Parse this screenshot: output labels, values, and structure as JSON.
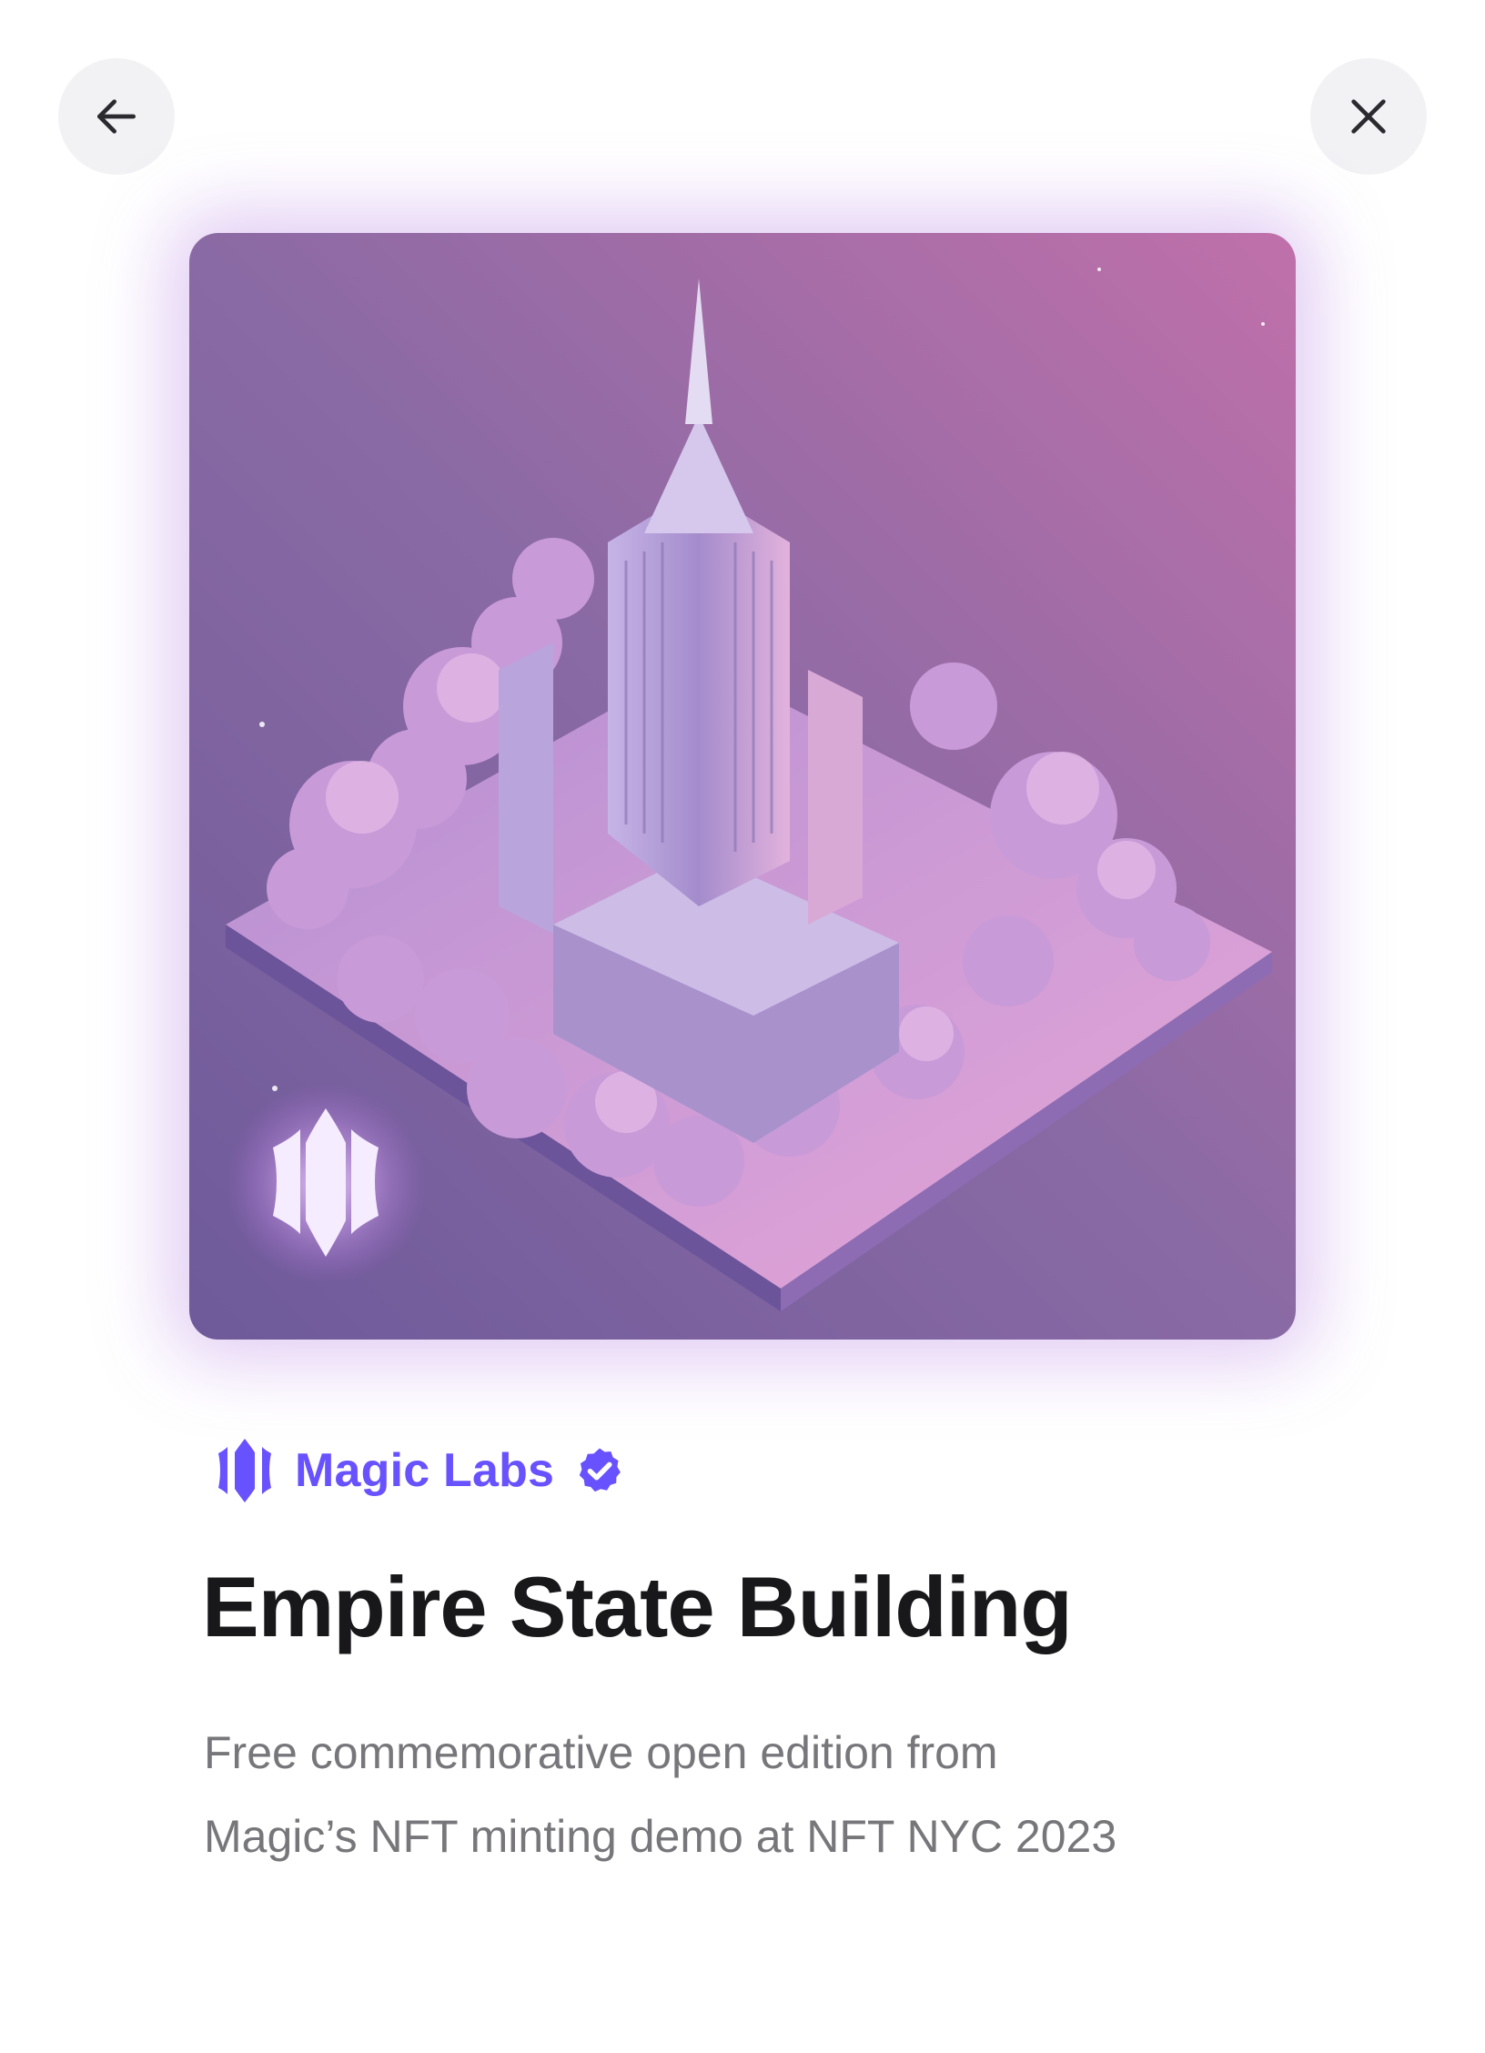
{
  "header": {
    "back_icon": "arrow-left-icon",
    "close_icon": "close-icon"
  },
  "nft": {
    "image_description_icon": "nft-artwork",
    "creator": {
      "name": "Magic Labs",
      "logo_icon": "magic-logo-icon",
      "verified_icon": "verified-badge-icon"
    },
    "title": "Empire State Building",
    "description_lines": [
      "Free commemorative open edition from",
      "Magic’s NFT minting demo at NFT NYC 2023"
    ]
  },
  "colors": {
    "accent": "#6851ff",
    "title": "#18171a",
    "description": "#77767a",
    "button_bg": "#f2f1f4"
  }
}
